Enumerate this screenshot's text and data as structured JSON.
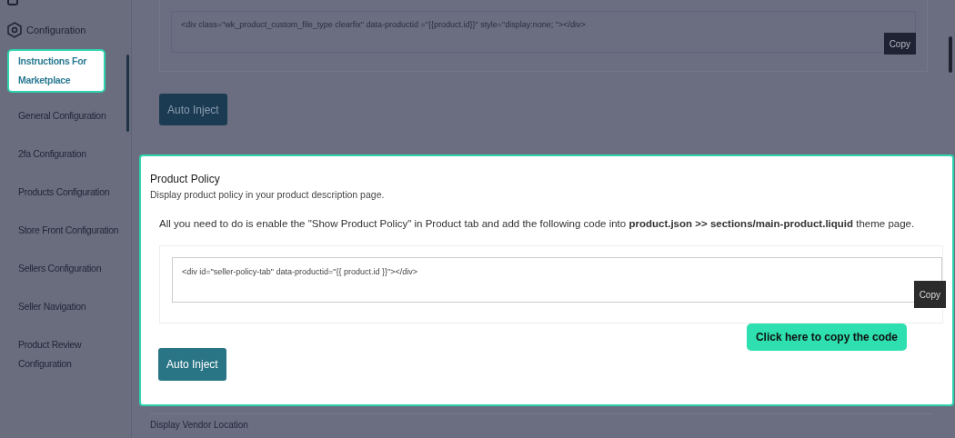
{
  "sidebar": {
    "section": {
      "label": "Configuration"
    },
    "items": [
      {
        "label": "Instructions For Marketplace",
        "selected": true
      },
      {
        "label": "General Configuration",
        "selected": false
      },
      {
        "label": "2fa Configuration",
        "selected": false
      },
      {
        "label": "Products Configuration",
        "selected": false
      },
      {
        "label": "Store Front Configuration",
        "selected": false
      },
      {
        "label": "Sellers Configuration",
        "selected": false
      },
      {
        "label": "Seller Navigation",
        "selected": false
      },
      {
        "label": "Product Review Configuration",
        "selected": false
      }
    ]
  },
  "top_section": {
    "code": "<div class=\"wk_product_custom_file_type clearfix\" data-productid =\"{{product.id}}\" style=\"display:none; \"></div>",
    "copy_button": "Copy",
    "inject_button": "Auto Inject"
  },
  "product_policy": {
    "title": "Product Policy",
    "subtitle": "Display product policy in your product description page.",
    "instruction": "All you need to do is enable the \"Show Product Policy\" in Product tab and add the following code into **product.json >> sections/main-product.liquid** theme page.",
    "code": "<div id=\"seller-policy-tab\" data-productid=\"{{ product.id }}\"></div>",
    "copy_button": "Copy",
    "callout": "Click here to copy the code",
    "inject_button": "Auto Inject"
  },
  "next_section": {
    "title": "Display Vendor Location"
  }
}
